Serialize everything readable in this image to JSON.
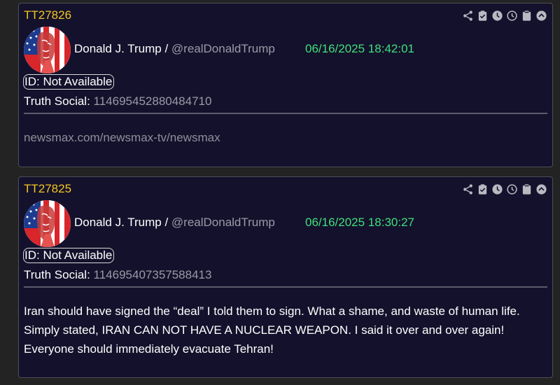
{
  "posts": [
    {
      "post_id": "TT27826",
      "author_name": "Donald J. Trump",
      "separator": " / ",
      "handle": "@realDonaldTrump",
      "timestamp": "06/16/2025 18:42:01",
      "id_badge": "ID: Not Available",
      "platform_label": "Truth Social:",
      "platform_number": "114695452880484710",
      "content": "newsmax.com/newsmax-tv/newsmax"
    },
    {
      "post_id": "TT27825",
      "author_name": "Donald J. Trump",
      "separator": " / ",
      "handle": "@realDonaldTrump",
      "timestamp": "06/16/2025 18:30:27",
      "id_badge": "ID: Not Available",
      "platform_label": "Truth Social:",
      "platform_number": "114695407357588413",
      "content": "Iran should have signed the “deal” I told them to sign. What a shame, and waste of human life. Simply stated, IRAN CAN NOT HAVE A NUCLEAR WEAPON. I said it over and over again! Everyone should immediately evacuate Tehran!"
    }
  ],
  "action_icons": [
    "share-icon",
    "clipboard-check-icon",
    "clock-filled-icon",
    "clock-outline-icon",
    "clipboard-icon",
    "chevron-up-circle-icon"
  ],
  "colors": {
    "page_background": "#232323",
    "card_background": "#14112c",
    "post_id": "#f3c620",
    "timestamp": "#3fe07a",
    "muted_text": "#9a9aa6",
    "icon": "#b9b9c2"
  }
}
